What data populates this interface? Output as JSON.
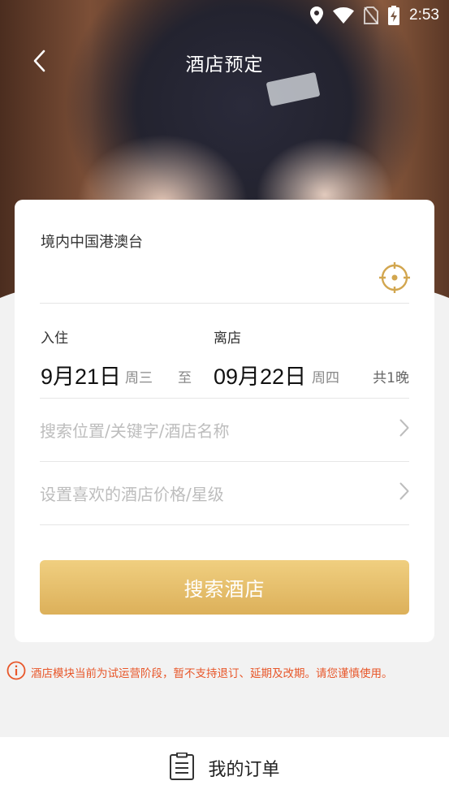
{
  "status_bar": {
    "time": "2:53"
  },
  "header": {
    "title": "酒店预定"
  },
  "card": {
    "region": "境内中国港澳台",
    "check_in": {
      "label": "入住",
      "date": "9月21日",
      "weekday": "周三"
    },
    "to_text": "至",
    "check_out": {
      "label": "离店",
      "date": "09月22日",
      "weekday": "周四"
    },
    "nights": "共1晚",
    "search_placeholder": "搜索位置/关键字/酒店名称",
    "filter_placeholder": "设置喜欢的酒店价格/星级",
    "search_button": "搜索酒店"
  },
  "notice": {
    "text": "酒店模块当前为试运营阶段，暂不支持退订、延期及改期。请您谨慎使用。"
  },
  "bottom_bar": {
    "orders_label": "我的订单"
  },
  "colors": {
    "accent_gold": "#dcb05a",
    "notice_orange": "#e8572a",
    "icon_gold": "#d2a64f"
  }
}
